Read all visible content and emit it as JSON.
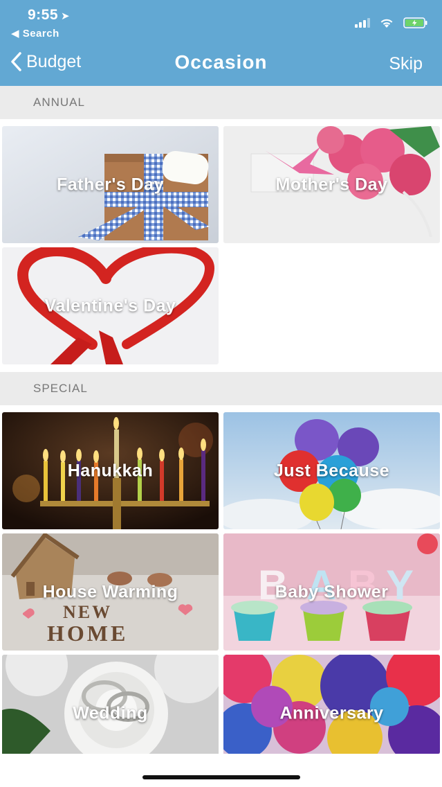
{
  "status_bar": {
    "time": "9:55",
    "back_app": "◀ Search"
  },
  "nav": {
    "back_label": "Budget",
    "title": "Occasion",
    "skip_label": "Skip"
  },
  "sections": [
    {
      "header": "ANNUAL",
      "items": [
        "Father's Day",
        "Mother's Day",
        "Valentine's Day"
      ]
    },
    {
      "header": "SPECIAL",
      "items": [
        "Hanukkah",
        "Just Because",
        "House Warming",
        "Baby Shower",
        "Wedding",
        "Anniversary"
      ]
    }
  ],
  "colors": {
    "header_bg": "#62a8d3",
    "section_bg": "#ebebeb",
    "section_text": "#777777"
  }
}
